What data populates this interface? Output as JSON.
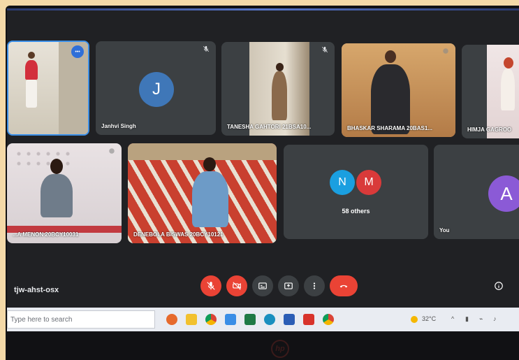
{
  "participants": [
    {
      "name": "",
      "type": "video"
    },
    {
      "name": "Janhvi Singh",
      "initial": "J",
      "type": "avatar"
    },
    {
      "name": "TANESHA GAHTORI 21BSA10...",
      "type": "video"
    },
    {
      "name": "BHASKAR SHARAMA 20BAS1...",
      "type": "video"
    },
    {
      "name": "HIMJA GAGROO",
      "type": "video"
    },
    {
      "name": "...A MENON 20BCY10031",
      "type": "video"
    },
    {
      "name": "DENEBOLA BISWAS 20BCY10121",
      "type": "video"
    },
    {
      "name": "58 others",
      "initials": [
        "N",
        "M"
      ],
      "type": "group"
    },
    {
      "name": "You",
      "initial": "A",
      "type": "avatar"
    }
  ],
  "meeting_code": "tjw-ahst-osx",
  "taskbar": {
    "search_placeholder": "Type here to search",
    "weather": "32°C"
  },
  "more_options_label": "•••",
  "colors": {
    "meet_bg": "#202124",
    "tile_bg": "#3c4043",
    "control_red": "#ea4335",
    "control_grey": "#3c4043",
    "avatar_blue": "#3f77b8",
    "avatar_N": "#1a9fe0",
    "avatar_M": "#d93a3a",
    "avatar_A": "#8b5ad6",
    "active_border": "#3b8fe8"
  },
  "icons": {
    "controls": [
      "mic-off-icon",
      "camera-off-icon",
      "captions-icon",
      "present-icon",
      "more-vert-icon",
      "end-call-icon"
    ],
    "info": "info-icon"
  }
}
